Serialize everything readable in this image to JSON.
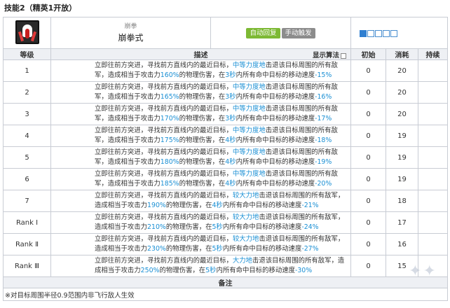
{
  "title": "技能2（精英1开放）",
  "skill": {
    "category": "崩拳",
    "name": "崩拳式",
    "tags": [
      "自动回复",
      "手动触发"
    ],
    "sp_boxes": 5,
    "sp_filled": 1
  },
  "columns": {
    "level": "等级",
    "desc": "描述",
    "formula": "显示算法",
    "init": "初始",
    "cost": "消耗",
    "duration": "持续"
  },
  "rows": [
    {
      "level": "1",
      "d1": "立即往前方突进，寻找前方直线内的最近目标，",
      "hl1": "中等力度地",
      "d2": "击退该目标周围的所有敌军，造成相当于攻击力",
      "hl2": "160%",
      "d3": "的物理伤害，在",
      "hl3": "3秒",
      "d4": "内所有命中目标的移动速度",
      "hl4": "-15%",
      "init": "0",
      "cost": "20",
      "duration": ""
    },
    {
      "level": "2",
      "d1": "立即往前方突进，寻找前方直线内的最近目标，",
      "hl1": "中等力度地",
      "d2": "击退该目标周围的所有敌军，造成相当于攻击力",
      "hl2": "165%",
      "d3": "的物理伤害，在",
      "hl3": "3秒",
      "d4": "内所有命中目标的移动速度",
      "hl4": "-16%",
      "init": "0",
      "cost": "20",
      "duration": ""
    },
    {
      "level": "3",
      "d1": "立即往前方突进，寻找前方直线内的最近目标，",
      "hl1": "中等力度地",
      "d2": "击退该目标周围的所有敌军，造成相当于攻击力",
      "hl2": "170%",
      "d3": "的物理伤害，在",
      "hl3": "3秒",
      "d4": "内所有命中目标的移动速度",
      "hl4": "-17%",
      "init": "0",
      "cost": "20",
      "duration": ""
    },
    {
      "level": "4",
      "d1": "立即往前方突进，寻找前方直线内的最近目标，",
      "hl1": "中等力度地",
      "d2": "击退该目标周围的所有敌军，造成相当于攻击力",
      "hl2": "175%",
      "d3": "的物理伤害，在",
      "hl3": "4秒",
      "d4": "内所有命中目标的移动速度",
      "hl4": "-18%",
      "init": "0",
      "cost": "19",
      "duration": ""
    },
    {
      "level": "5",
      "d1": "立即往前方突进，寻找前方直线内的最近目标，",
      "hl1": "中等力度地",
      "d2": "击退该目标周围的所有敌军，造成相当于攻击力",
      "hl2": "180%",
      "d3": "的物理伤害，在",
      "hl3": "4秒",
      "d4": "内所有命中目标的移动速度",
      "hl4": "-19%",
      "init": "0",
      "cost": "19",
      "duration": ""
    },
    {
      "level": "6",
      "d1": "立即往前方突进，寻找前方直线内的最近目标，",
      "hl1": "中等力度地",
      "d2": "击退该目标周围的所有敌军，造成相当于攻击力",
      "hl2": "185%",
      "d3": "的物理伤害，在",
      "hl3": "4秒",
      "d4": "内所有命中目标的移动速度",
      "hl4": "-20%",
      "init": "0",
      "cost": "19",
      "duration": ""
    },
    {
      "level": "7",
      "d1": "立即往前方突进，寻找前方直线内的最近目标，",
      "hl1": "较大力地",
      "d2": "击退该目标周围的所有敌军，造成相当于攻击力",
      "hl2": "190%",
      "d3": "的物理伤害，在",
      "hl3": "4秒",
      "d4": "内所有命中目标的移动速度",
      "hl4": "-21%",
      "init": "0",
      "cost": "18",
      "duration": ""
    },
    {
      "level": "Rank Ⅰ",
      "d1": "立即往前方突进，寻找前方直线内的最近目标，",
      "hl1": "较大力地",
      "d2": "击退该目标周围的所有敌军，造成相当于攻击力",
      "hl2": "210%",
      "d3": "的物理伤害，在",
      "hl3": "5秒",
      "d4": "内所有命中目标的移动速度",
      "hl4": "-24%",
      "init": "0",
      "cost": "17",
      "duration": ""
    },
    {
      "level": "Rank Ⅱ",
      "d1": "立即往前方突进，寻找前方直线内的最近目标，",
      "hl1": "较大力地",
      "d2": "击退该目标周围的所有敌军，造成相当于攻击力",
      "hl2": "230%",
      "d3": "的物理伤害，在",
      "hl3": "5秒",
      "d4": "内所有命中目标的移动速度",
      "hl4": "-27%",
      "init": "0",
      "cost": "16",
      "duration": ""
    },
    {
      "level": "Rank Ⅲ",
      "d1": "立即往前方突进，寻找前方直线内的最近目标，",
      "hl1": "大力地",
      "d2": "击退该目标周围的所有敌军，造成相当于攻击力",
      "hl2": "250%",
      "d3": "的物理伤害，在",
      "hl3": "5秒",
      "d4": "内所有命中目标的移动速度",
      "hl4": "-30%",
      "init": "0",
      "cost": "15",
      "duration": ""
    }
  ],
  "note": {
    "header": "备注",
    "text": "※对目标周围半径0.9范围内非飞行敌人生效"
  },
  "colors": {
    "highlight": "#1a8fd4",
    "tag_auto": "#7db934",
    "tag_manual": "#8c8c8c",
    "header_bg": "#eef0f4"
  }
}
